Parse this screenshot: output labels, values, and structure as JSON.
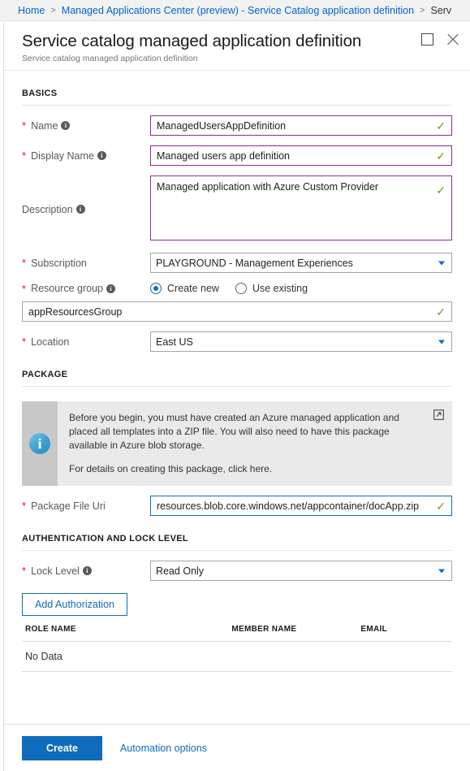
{
  "breadcrumb": {
    "items": [
      {
        "label": "Home",
        "link": true
      },
      {
        "label": "Managed Applications Center (preview) - Service Catalog application definition",
        "link": true
      },
      {
        "label": "Serv",
        "link": false
      }
    ],
    "separator": ">"
  },
  "blade": {
    "title": "Service catalog managed application definition",
    "subtitle": "Service catalog managed application definition",
    "maximize_icon": "maximize-icon",
    "close_icon": "close-icon"
  },
  "sections": {
    "basics": "BASICS",
    "package": "PACKAGE",
    "auth": "AUTHENTICATION AND LOCK LEVEL"
  },
  "fields": {
    "name": {
      "label": "Name",
      "required": true,
      "info": true,
      "value": "ManagedUsersAppDefinition",
      "valid": true
    },
    "display_name": {
      "label": "Display Name",
      "required": true,
      "info": true,
      "value": "Managed users app definition",
      "valid": true
    },
    "description": {
      "label": "Description",
      "required": false,
      "info": true,
      "value": "Managed application with Azure Custom Provider",
      "valid": true
    },
    "subscription": {
      "label": "Subscription",
      "required": true,
      "info": false,
      "value": "PLAYGROUND - Management Experiences",
      "options": [
        "PLAYGROUND - Management Experiences"
      ]
    },
    "resource_group": {
      "label": "Resource group",
      "required": true,
      "info": true,
      "mode": "Create new",
      "options": [
        "Create new",
        "Use existing"
      ],
      "value": "appResourcesGroup",
      "valid": true
    },
    "location": {
      "label": "Location",
      "required": true,
      "info": false,
      "value": "East US",
      "options": [
        "East US"
      ]
    },
    "package_file_uri": {
      "label": "Package File Uri",
      "required": true,
      "info": false,
      "value": "resources.blob.core.windows.net/appcontainer/docApp.zip",
      "valid": true,
      "focused": true
    },
    "lock_level": {
      "label": "Lock Level",
      "required": true,
      "info": true,
      "value": "Read Only",
      "options": [
        "Read Only"
      ]
    }
  },
  "infobox": {
    "icon": "information-icon",
    "external_link_icon": "external-link-icon",
    "paragraph1": "Before you begin, you must have created an Azure managed application and placed all templates into a ZIP file. You will also need to have this package available in Azure blob storage.",
    "paragraph2": "For details on creating this package, click here."
  },
  "authorization": {
    "add_button": "Add Authorization",
    "columns": [
      "ROLE NAME",
      "MEMBER NAME",
      "EMAIL"
    ],
    "empty_text": "No Data",
    "rows": []
  },
  "footer": {
    "create_label": "Create",
    "automation_label": "Automation options"
  },
  "colors": {
    "accent_blue": "#0f6cbd",
    "link_blue": "#0066cc",
    "required_red": "#e81123",
    "valid_green": "#6aa116",
    "input_purple": "#8a2f91",
    "info_band": "#c8c8c8",
    "info_bg": "#eaeaea"
  }
}
